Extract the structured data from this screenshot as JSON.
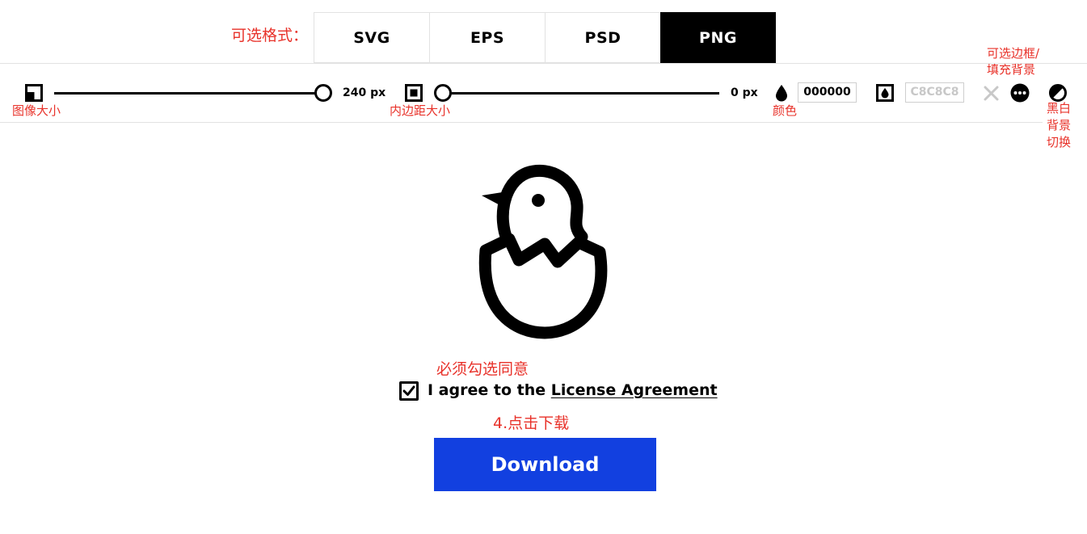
{
  "annotations": {
    "formats_note": "可选格式：",
    "border_fill_note_1": "可选边框/",
    "border_fill_note_2": "填充背景",
    "image_size_note": "图像大小",
    "padding_note": "内边距大小",
    "color_note": "颜色",
    "bw_toggle_note_1": "黑白",
    "bw_toggle_note_2": "背景",
    "bw_toggle_note_3": "切换",
    "must_agree_note": "必须勾选同意",
    "click_download_note": "4.点击下载"
  },
  "formats": {
    "tabs": [
      {
        "label": "SVG",
        "active": false
      },
      {
        "label": "EPS",
        "active": false
      },
      {
        "label": "PSD",
        "active": false
      },
      {
        "label": "PNG",
        "active": true
      }
    ]
  },
  "toolbar": {
    "size": {
      "value": 240,
      "value_label": "240 px"
    },
    "padding": {
      "value": 0,
      "value_label": "0 px"
    },
    "color": {
      "value": "000000",
      "hex": "#000000",
      "icon": "drop-icon"
    },
    "background": {
      "value": "C8C8C8",
      "hex": "#c8c8c8",
      "icon": "drop-in-square-icon"
    },
    "icons": [
      "image-size-icon",
      "padding-icon",
      "close-icon",
      "more-icon",
      "contrast-icon"
    ]
  },
  "preview": {
    "icon": "hatching-chick-icon"
  },
  "agreement": {
    "checked": true,
    "prefix": "I agree to the",
    "link": "License Agreement"
  },
  "download": {
    "label": "Download",
    "color": "#1240e0"
  },
  "colors": {
    "annotation": "#e8322a",
    "accent": "#1240e0"
  }
}
